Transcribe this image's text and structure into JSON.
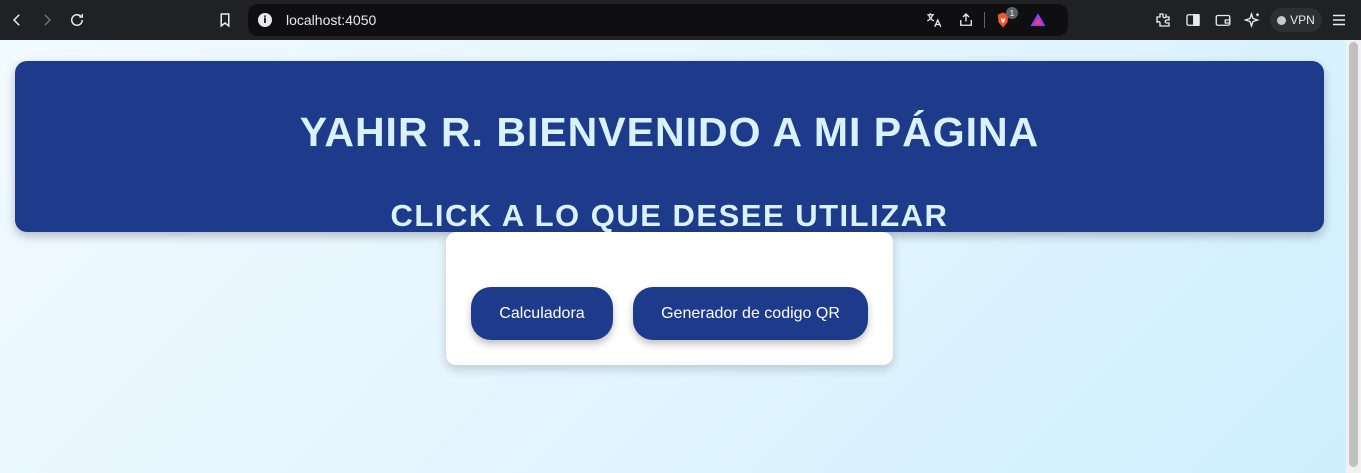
{
  "browser": {
    "url": "localhost:4050",
    "info_glyph": "i",
    "brave_badge_count": "1",
    "vpn_label": "VPN",
    "icons": [
      "back-icon",
      "forward-icon",
      "reload-icon",
      "bookmark-icon",
      "info-icon",
      "translate-icon",
      "share-icon",
      "brave-shield-icon",
      "brave-rewards-icon",
      "extensions-icon",
      "sidebar-icon",
      "wallet-icon",
      "leo-ai-icon",
      "menu-icon"
    ]
  },
  "page": {
    "title": "YAHIR R. BIENVENIDO A MI PÁGINA",
    "subtitle": "CLICK A LO QUE DESEE UTILIZAR",
    "buttons": {
      "calculator": "Calculadora",
      "qr_generator": "Generador de codigo QR"
    }
  },
  "colors": {
    "header_bg": "#1e3a8a",
    "header_text": "#d8f3ff",
    "button_bg": "#1e3a8a",
    "button_text": "#ffffff",
    "chrome_bg": "#202124"
  }
}
